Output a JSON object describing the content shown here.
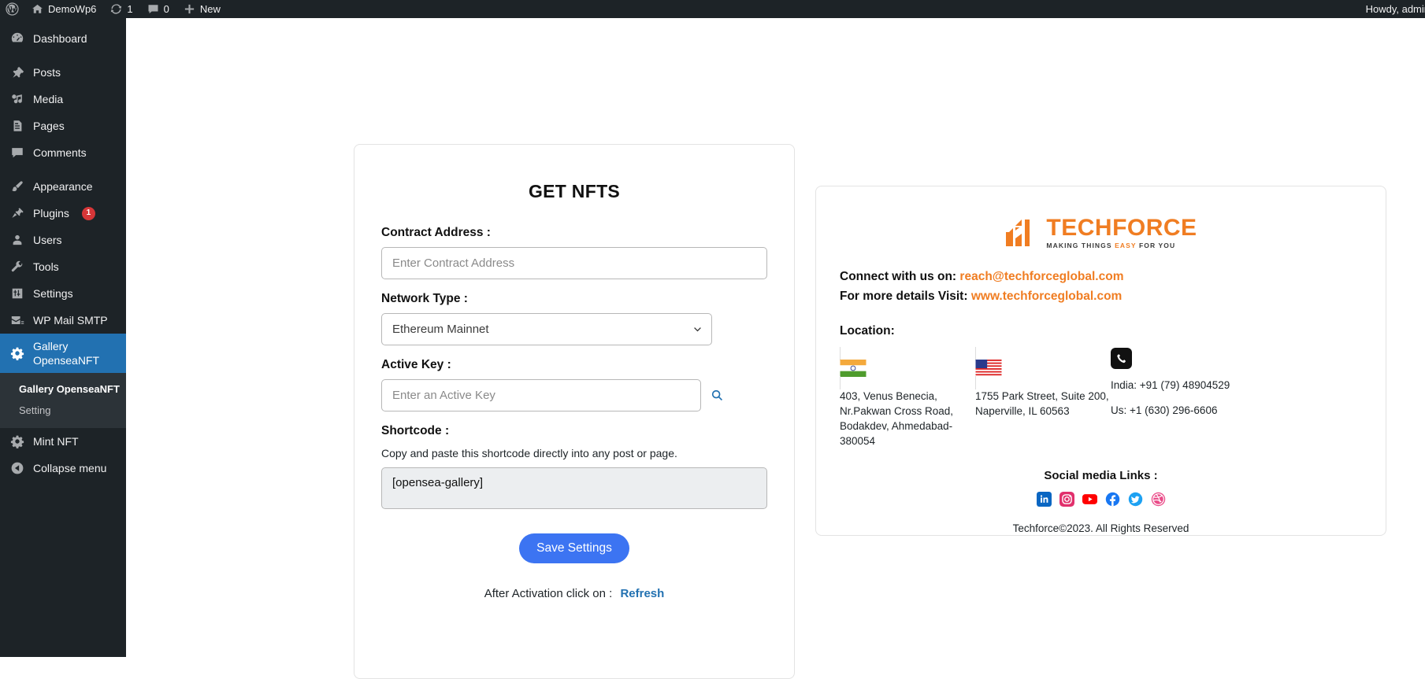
{
  "adminbar": {
    "logo_icon": "wordpress-logo-icon",
    "site_icon": "home-icon",
    "site_name": "DemoWp6",
    "updates_icon": "updates-icon",
    "updates_count": "1",
    "comments_icon": "comment-bubble-icon",
    "comments_count": "0",
    "new_icon": "plus-icon",
    "new_label": "New",
    "howdy": "Howdy, admin"
  },
  "sidebar": {
    "items": [
      {
        "label": "Dashboard",
        "icon": "dashboard-icon"
      },
      {
        "label": "Posts",
        "icon": "pin-icon"
      },
      {
        "label": "Media",
        "icon": "media-icon"
      },
      {
        "label": "Pages",
        "icon": "pages-icon"
      },
      {
        "label": "Comments",
        "icon": "comment-icon"
      },
      {
        "label": "Appearance",
        "icon": "brush-icon"
      },
      {
        "label": "Plugins",
        "icon": "plug-icon",
        "badge": "1"
      },
      {
        "label": "Users",
        "icon": "user-icon"
      },
      {
        "label": "Tools",
        "icon": "wrench-icon"
      },
      {
        "label": "Settings",
        "icon": "settings-sliders-icon"
      },
      {
        "label": "WP Mail SMTP",
        "icon": "envelope-icon"
      },
      {
        "label": "Gallery\nOpenseaNFT",
        "icon": "gear-icon",
        "active": true
      },
      {
        "label": "Mint NFT",
        "icon": "gear-icon"
      },
      {
        "label": "Collapse menu",
        "icon": "collapse-arrow-icon"
      }
    ],
    "submenu": [
      {
        "label": "Gallery OpenseaNFT",
        "current": true
      },
      {
        "label": "Setting",
        "current": false
      }
    ]
  },
  "form": {
    "title": "GET NFTS",
    "contract_label": "Contract Address :",
    "contract_placeholder": "Enter Contract Address",
    "contract_value": "",
    "network_label": "Network Type :",
    "network_value": "Ethereum Mainnet",
    "active_key_label": "Active Key :",
    "active_key_placeholder": "Enter an Active Key",
    "active_key_value": "",
    "search_icon": "magnifier-icon",
    "shortcode_label": "Shortcode :",
    "shortcode_hint": "Copy and paste this shortcode directly into any post or page.",
    "shortcode_value": "[opensea-gallery]",
    "save_label": "Save Settings",
    "after_text": "After Activation click on :",
    "refresh_label": "Refresh"
  },
  "info": {
    "logo_word": "TECHFORCE",
    "logo_tag_a": "MAKING THINGS ",
    "logo_tag_hl": "EASY",
    "logo_tag_b": " FOR YOU",
    "connect_label": "Connect with us on:",
    "connect_value": "reach@techforceglobal.com",
    "visit_label": "For more details Visit:",
    "visit_value": "www.techforceglobal.com",
    "location_title": "Location:",
    "india_flag_icon": "india-flag-icon",
    "india_address": "403, Venus Benecia, Nr.Pakwan Cross Road, Bodakdev, Ahmedabad-380054",
    "us_flag_icon": "us-flag-icon",
    "us_address": "1755 Park Street, Suite 200, Naperville, IL 60563",
    "phone_icon": "phone-icon",
    "phone_india": "India: +91 (79) 48904529",
    "phone_us": "Us: +1 (630) 296-6606",
    "social_title": "Social media Links :",
    "social": [
      {
        "name": "linkedin-icon",
        "color": "#0a66c2"
      },
      {
        "name": "instagram-icon",
        "color": "#e1306c"
      },
      {
        "name": "youtube-icon",
        "color": "#ff0000"
      },
      {
        "name": "facebook-icon",
        "color": "#1877f2"
      },
      {
        "name": "twitter-icon",
        "color": "#1da1f2"
      },
      {
        "name": "dribbble-icon",
        "color": "#ea4c89"
      }
    ],
    "copyright": "Techforce©2023. All Rights Reserved"
  },
  "colors": {
    "admin_dark": "#1d2327",
    "admin_blue": "#2271b1",
    "brand_orange": "#f07d22",
    "button_blue": "#3c74f2"
  }
}
